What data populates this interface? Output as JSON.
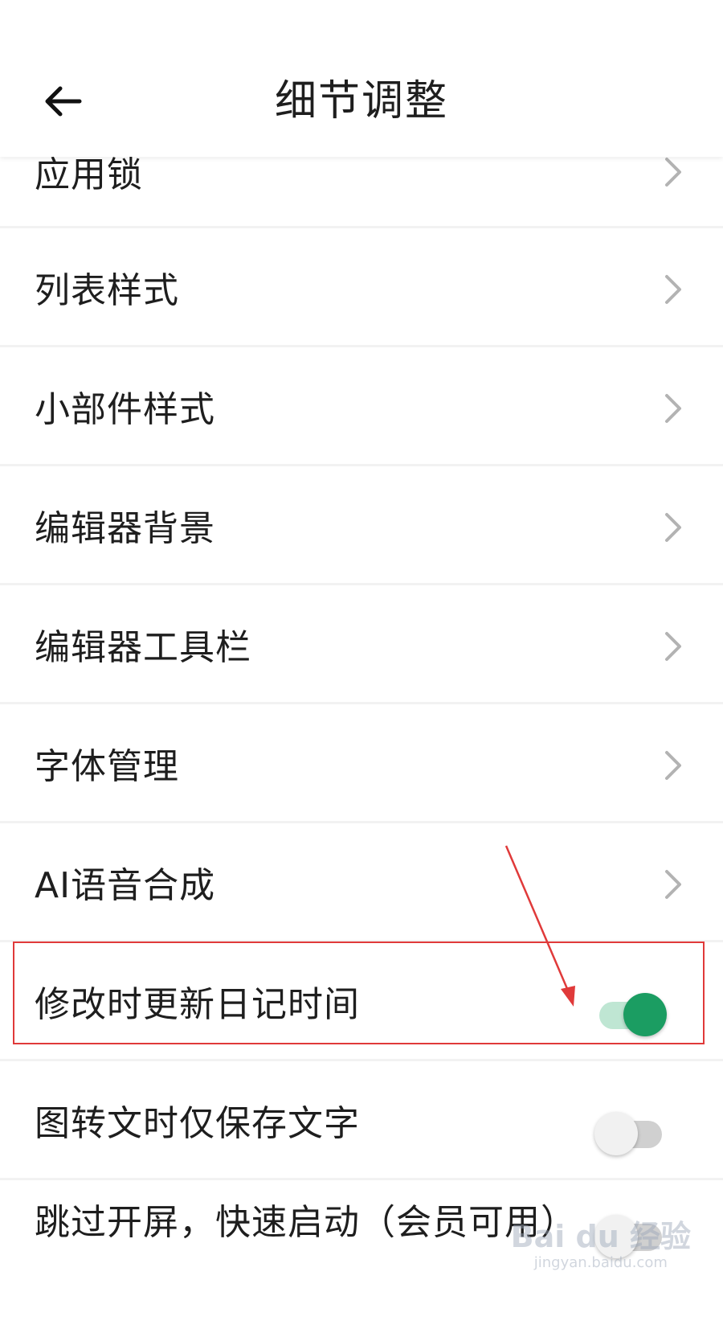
{
  "header": {
    "title": "细节调整",
    "back_icon": "arrow-left-icon"
  },
  "settings": {
    "items": [
      {
        "label": "应用锁",
        "control": "chevron-right-icon"
      },
      {
        "label": "列表样式",
        "control": "chevron-right-icon"
      },
      {
        "label": "小部件样式",
        "control": "chevron-right-icon"
      },
      {
        "label": "编辑器背景",
        "control": "chevron-right-icon"
      },
      {
        "label": "编辑器工具栏",
        "control": "chevron-right-icon"
      },
      {
        "label": "字体管理",
        "control": "chevron-right-icon"
      },
      {
        "label": "AI语音合成",
        "control": "chevron-right-icon"
      },
      {
        "label": "修改时更新日记时间",
        "control": "toggle",
        "enabled": true
      },
      {
        "label": "图转文时仅保存文字",
        "control": "toggle",
        "enabled": false
      },
      {
        "label": "跳过开屏，快速启动（会员可用）",
        "control": "toggle",
        "enabled": false
      }
    ]
  },
  "annotation": {
    "highlight_color": "#e03a3a",
    "target": "修改时更新日记时间"
  },
  "colors": {
    "toggle_on": "#1b9d62",
    "toggle_on_track": "#bfe6d3",
    "toggle_off_track": "#d0d0d0",
    "chevron": "#b3b3b3"
  },
  "watermark": {
    "logo": "Bai du 经验",
    "url": "jingyan.baidu.com"
  }
}
